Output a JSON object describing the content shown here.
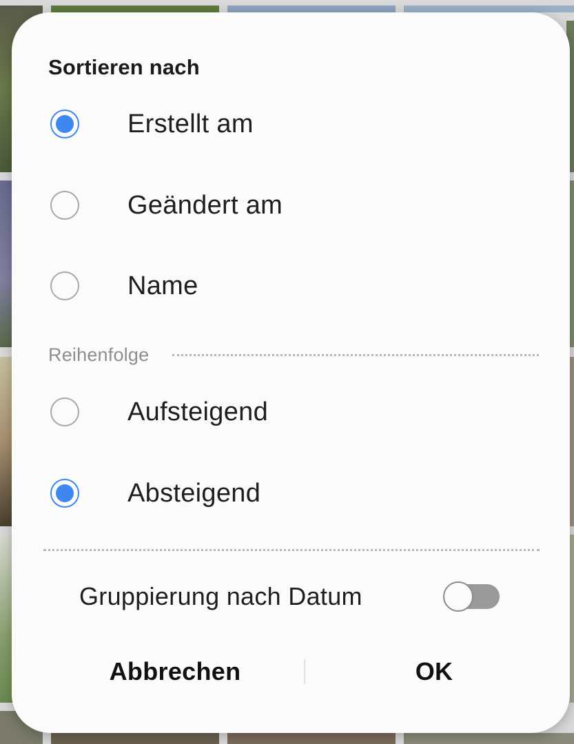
{
  "dialog": {
    "title": "Sortieren nach",
    "sort_options": [
      {
        "label": "Erstellt am",
        "selected": true
      },
      {
        "label": "Geändert am",
        "selected": false
      },
      {
        "label": "Name",
        "selected": false
      }
    ],
    "order_section_label": "Reihenfolge",
    "order_options": [
      {
        "label": "Aufsteigend",
        "selected": false
      },
      {
        "label": "Absteigend",
        "selected": true
      }
    ],
    "group_by_date": {
      "label": "Gruppierung nach Datum",
      "enabled": false
    },
    "cancel_label": "Abbrechen",
    "ok_label": "OK"
  },
  "colors": {
    "accent": "#3e87f0",
    "dialog_background": "#fbfbfb",
    "toggle_track_off": "#9a9a9a"
  }
}
